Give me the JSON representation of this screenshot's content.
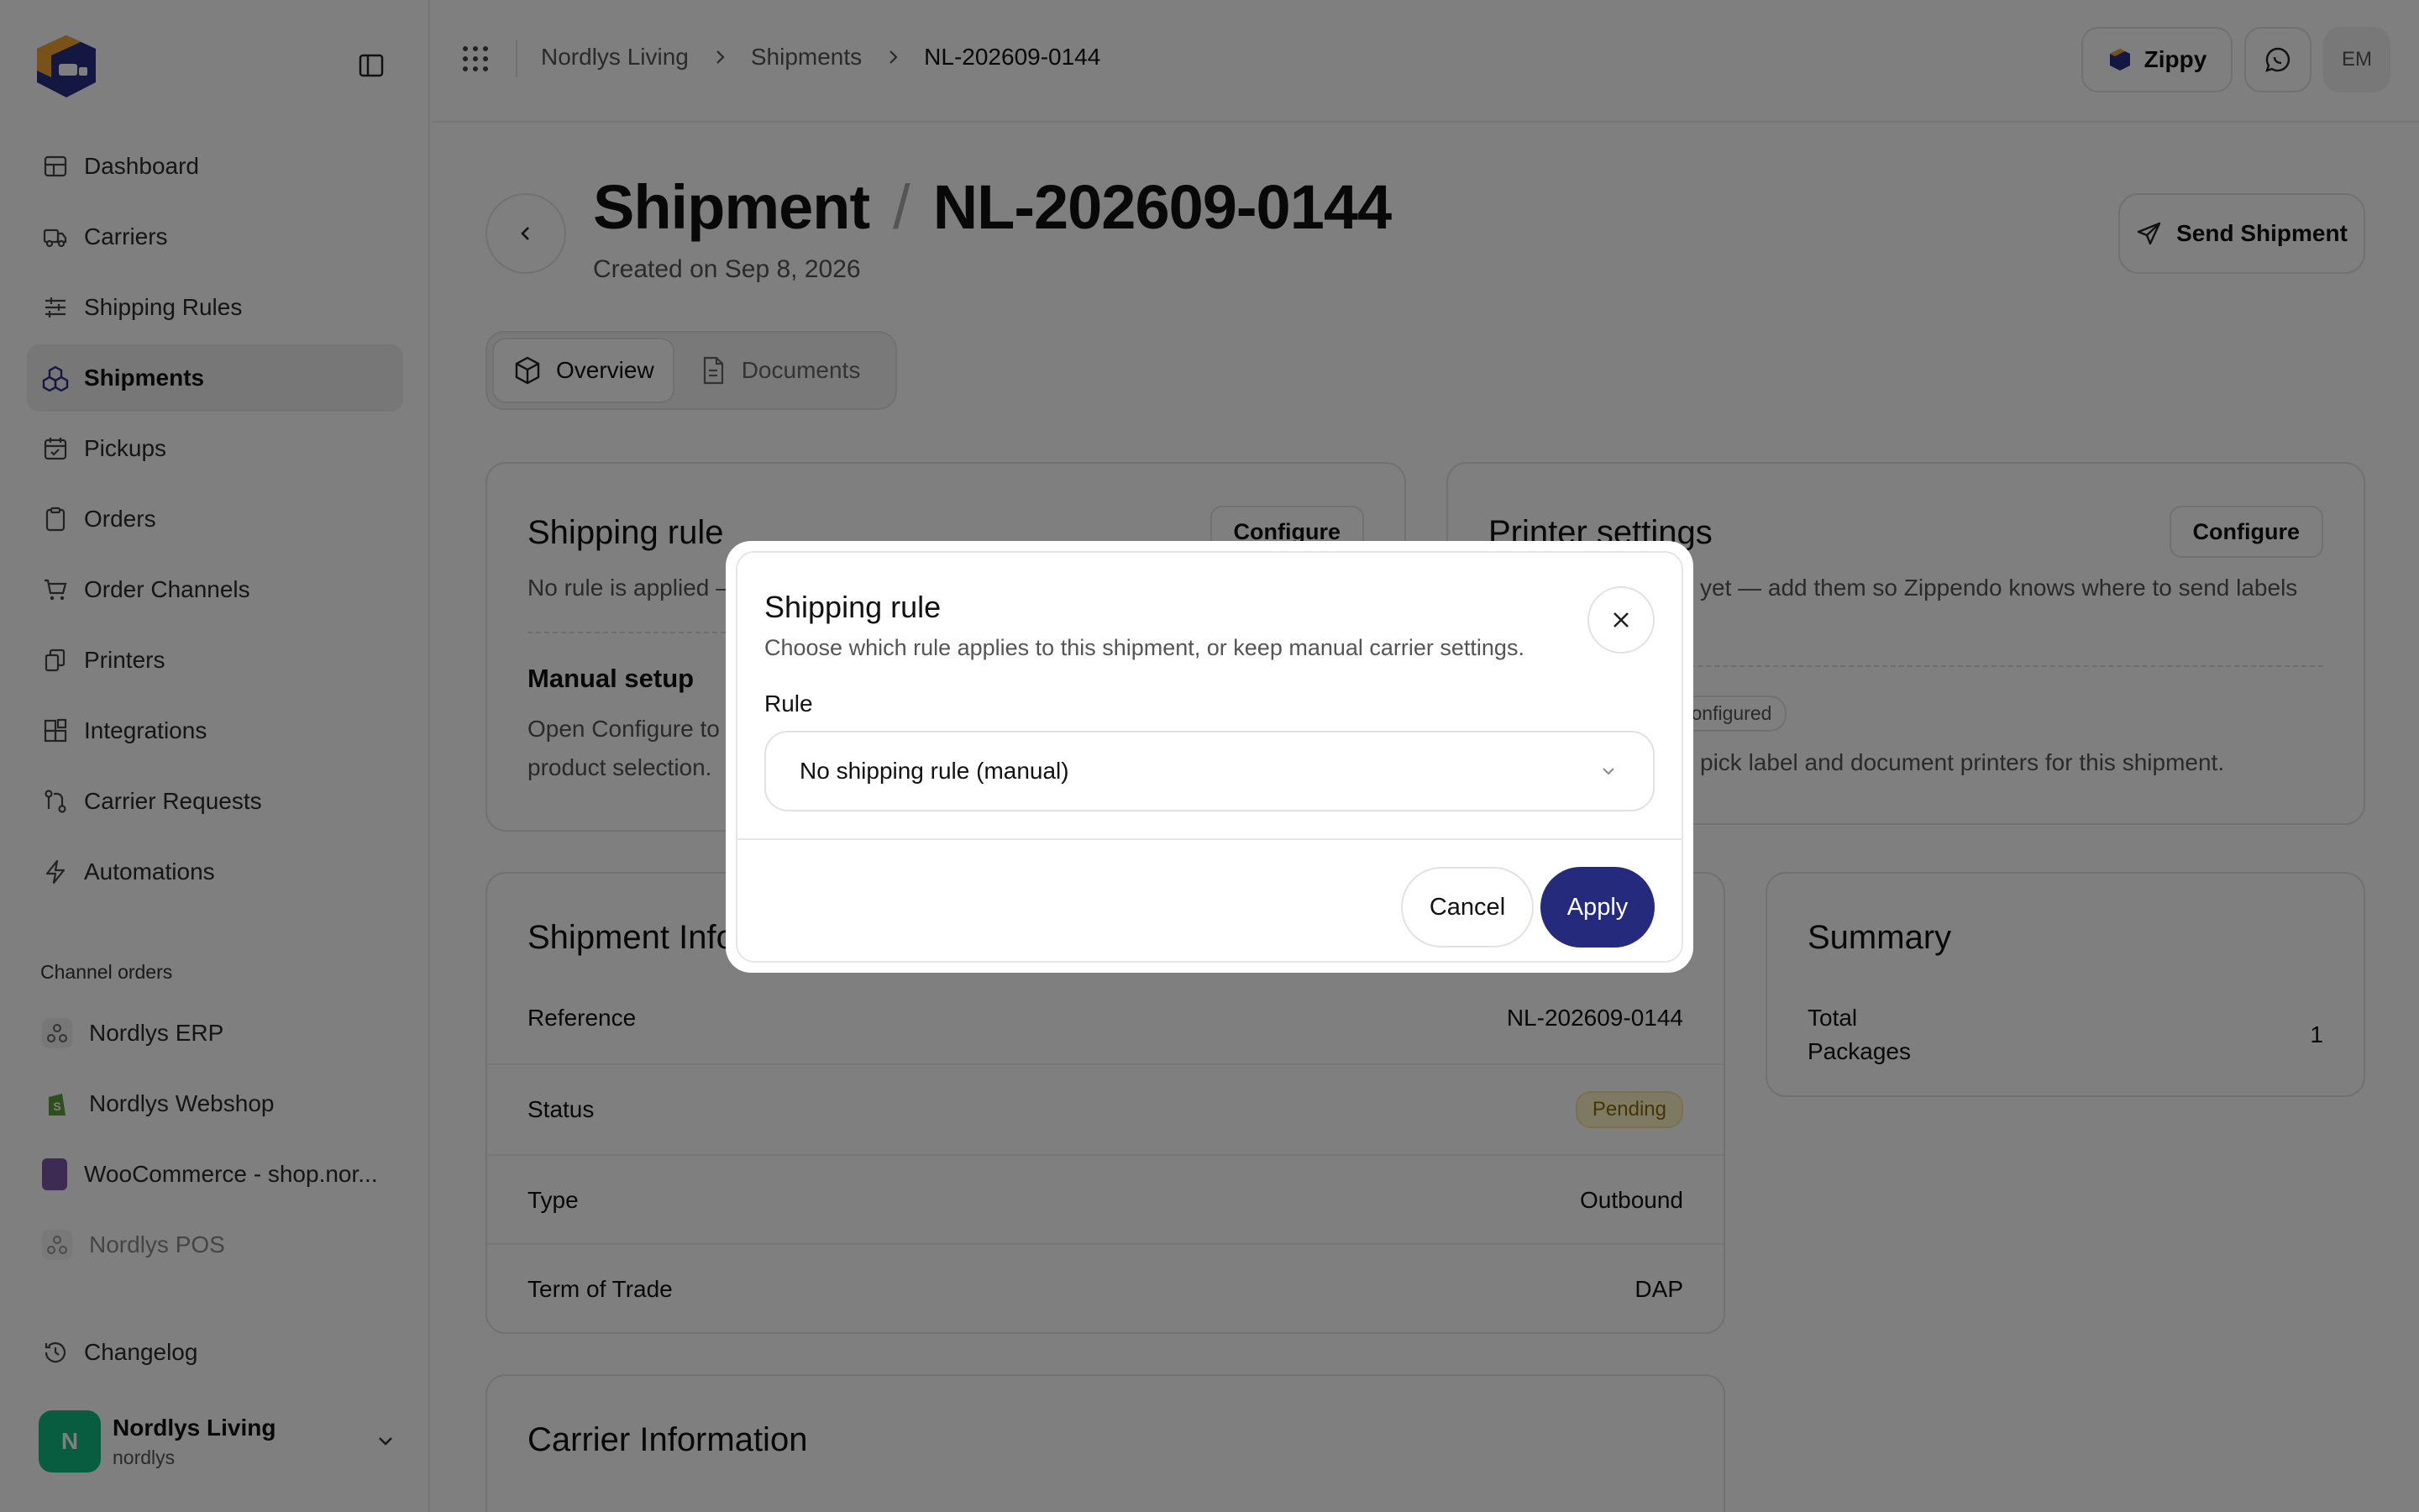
{
  "sidebar": {
    "nav": [
      {
        "label": "Dashboard",
        "icon": "dashboard-icon"
      },
      {
        "label": "Carriers",
        "icon": "truck-icon"
      },
      {
        "label": "Shipping Rules",
        "icon": "sliders-icon"
      },
      {
        "label": "Shipments",
        "icon": "boxes-icon",
        "active": true
      },
      {
        "label": "Pickups",
        "icon": "calendar-icon"
      },
      {
        "label": "Orders",
        "icon": "clipboard-icon"
      },
      {
        "label": "Order Channels",
        "icon": "cart-icon"
      },
      {
        "label": "Printers",
        "icon": "printer-icon"
      },
      {
        "label": "Integrations",
        "icon": "blocks-icon"
      },
      {
        "label": "Carrier Requests",
        "icon": "route-icon"
      },
      {
        "label": "Automations",
        "icon": "bolt-icon"
      }
    ],
    "channels_label": "Channel orders",
    "channels": [
      {
        "label": "Nordlys ERP"
      },
      {
        "label": "Nordlys Webshop"
      },
      {
        "label": "WooCommerce - shop.nor..."
      },
      {
        "label": "Nordlys POS"
      }
    ],
    "changelog": "Changelog",
    "account": {
      "initial": "N",
      "name": "Nordlys Living",
      "handle": "nordlys"
    }
  },
  "topbar": {
    "breadcrumb": [
      "Nordlys Living",
      "Shipments",
      "NL-202609-0144"
    ],
    "zippy_label": "Zippy",
    "user_initials": "EM"
  },
  "page": {
    "title": "Shipment",
    "title_separator": "/",
    "shipment_id": "NL-202609-0144",
    "created": "Created on Sep 8, 2026",
    "send_label": "Send Shipment",
    "tabs": [
      {
        "label": "Overview",
        "active": true
      },
      {
        "label": "Documents"
      }
    ]
  },
  "shipping_rule_card": {
    "title": "Shipping rule",
    "configure": "Configure",
    "desc": "No rule is applied —",
    "manual_title": "Manual setup",
    "manual_desc_1": "Open Configure to p",
    "manual_desc_2": "product selection."
  },
  "printer_card": {
    "title": "Printer settings",
    "configure": "Configure",
    "desc": "yet — add them so Zippendo knows where to send labels",
    "pill": "configured",
    "desc2": "pick label and document printers for this shipment."
  },
  "shipment_info": {
    "title": "Shipment Info",
    "rows": [
      {
        "label": "Reference",
        "value": "NL-202609-0144"
      },
      {
        "label": "Status",
        "value": "Pending"
      },
      {
        "label": "Type",
        "value": "Outbound"
      },
      {
        "label": "Term of Trade",
        "value": "DAP"
      }
    ]
  },
  "summary": {
    "title": "Summary",
    "label_line1": "Total",
    "label_line2": "Packages",
    "value": "1"
  },
  "carrier_info": {
    "title": "Carrier Information"
  },
  "modal": {
    "title": "Shipping rule",
    "desc": "Choose which rule applies to this shipment, or keep manual carrier settings.",
    "field_label": "Rule",
    "selected": "No shipping rule (manual)",
    "cancel": "Cancel",
    "apply": "Apply"
  },
  "colors": {
    "accent": "#262a7d",
    "pending_bg": "#fdf3c7",
    "avatar_green": "#10b981"
  }
}
